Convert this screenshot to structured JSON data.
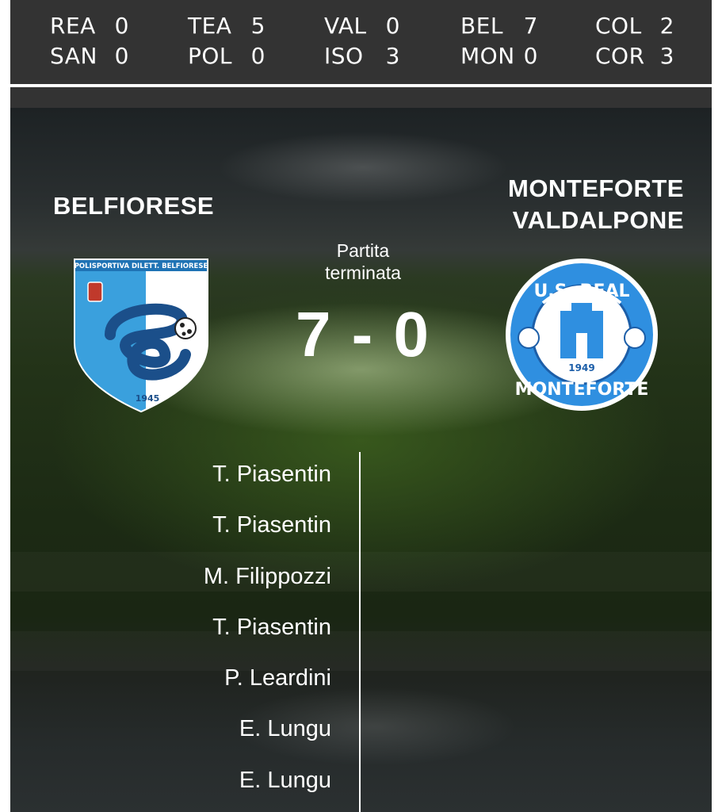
{
  "ticker": [
    {
      "home": "REA",
      "home_score": "0",
      "away": "SAN",
      "away_score": "0"
    },
    {
      "home": "TEA",
      "home_score": "5",
      "away": "POL",
      "away_score": "0"
    },
    {
      "home": "VAL",
      "home_score": "0",
      "away": "ISO",
      "away_score": "3"
    },
    {
      "home": "BEL",
      "home_score": "7",
      "away": "MON",
      "away_score": "0"
    },
    {
      "home": "COL",
      "home_score": "2",
      "away": "COR",
      "away_score": "3"
    }
  ],
  "match": {
    "home_team": "BELFIORESE",
    "away_team_line1": "MONTEFORTE",
    "away_team_line2": "VALDALPONE",
    "status_line1": "Partita",
    "status_line2": "terminata",
    "score": "7 - 0",
    "home_logo": {
      "top_text": "POLISPORTIVA DILETT. BELFIORESE",
      "year": "1945"
    },
    "away_logo": {
      "top_text": "U.S. REAL",
      "bottom_text": "MONTEFORTE",
      "year": "1949"
    }
  },
  "home_scorers": [
    "T. Piasentin",
    "T. Piasentin",
    "M. Filippozzi",
    "T. Piasentin",
    "P. Leardini",
    "E. Lungu",
    "E. Lungu"
  ],
  "colors": {
    "ticker_bg": "#333333",
    "text": "#ffffff",
    "home_blue": "#3aa0dd",
    "away_blue": "#2f8fe0"
  }
}
